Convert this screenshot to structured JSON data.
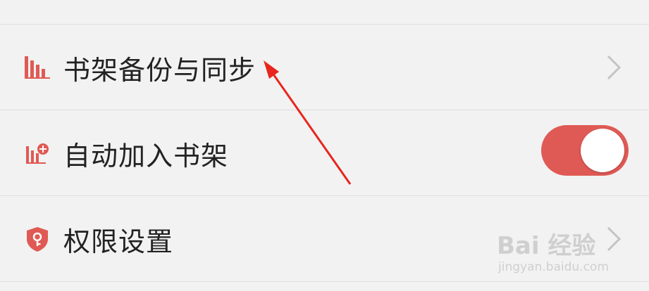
{
  "settings": {
    "rows": [
      {
        "label": "书架备份与同步",
        "icon": "bar-chart-icon",
        "control": "chevron"
      },
      {
        "label": "自动加入书架",
        "icon": "bar-chart-plus-icon",
        "control": "toggle",
        "toggle_on": true
      },
      {
        "label": "权限设置",
        "icon": "shield-key-icon",
        "control": "chevron"
      }
    ]
  },
  "colors": {
    "accent": "#e05a55",
    "background": "#f2f2f2",
    "divider": "#dedede",
    "annotation_arrow": "#e8261d"
  },
  "watermark": {
    "brand": "Bai 经验",
    "url": "jingyan.baidu.com"
  }
}
